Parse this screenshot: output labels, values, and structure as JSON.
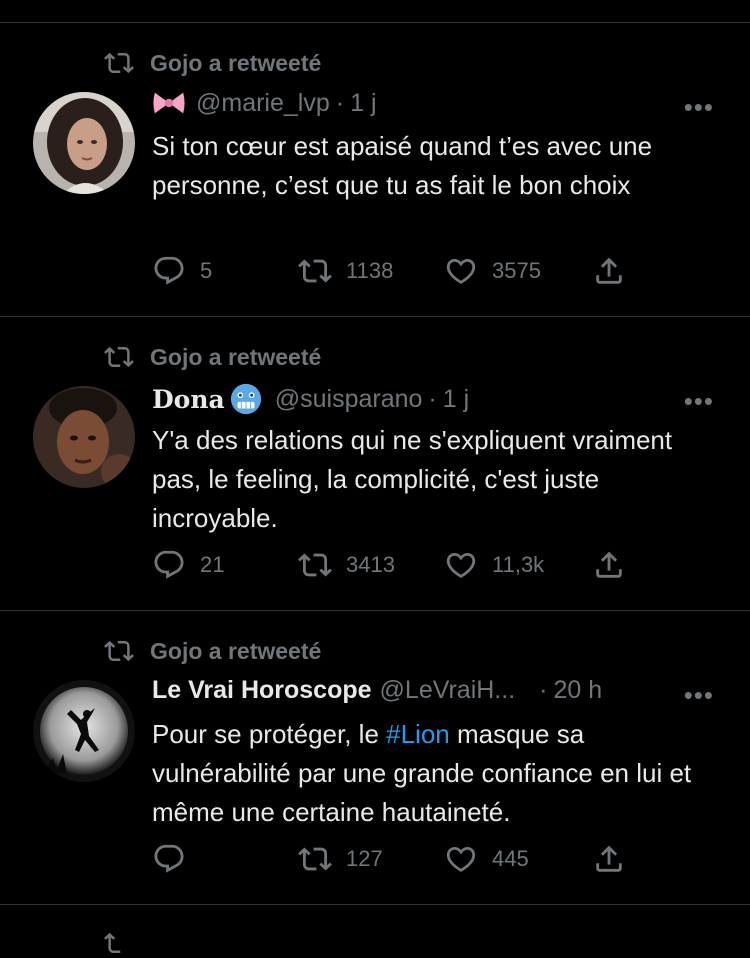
{
  "tweets": [
    {
      "retweet_label": "Gojo a retweeté",
      "name": "",
      "handle": "@marie_lvp",
      "separator": "·",
      "time": "1 j",
      "more": "•••",
      "text": "Si ton cœur est apaisé quand t’es avec une personne, c’est que tu as fait le bon choix",
      "reply_count": "5",
      "retweet_count": "1138",
      "like_count": "3575"
    },
    {
      "retweet_label": "Gojo a retweeté",
      "name": "Dona",
      "handle": "@suisparano",
      "separator": "·",
      "time": "1 j",
      "more": "•••",
      "text": "Y'a des relations qui ne s'expliquent vraiment pas, le feeling, la complicité, c'est juste incroyable.",
      "reply_count": "21",
      "retweet_count": "3413",
      "like_count": "11,3k"
    },
    {
      "retweet_label": "Gojo a retweeté",
      "name": "Le Vrai Horoscope",
      "handle": "@LeVraiH...",
      "separator": "·",
      "time": "20 h",
      "more": "•••",
      "text_before": "Pour se protéger, le ",
      "hashtag": "#Lion",
      "text_after": " masque sa vulnérabilité par une grande confiance en lui et même une certaine hautaineté.",
      "reply_count": "",
      "retweet_count": "127",
      "like_count": "445"
    }
  ],
  "colors": {
    "background": "#000000",
    "text": "#e7e9ea",
    "muted": "#71767b",
    "link": "#1d9bf0",
    "divider": "#2f3336"
  }
}
